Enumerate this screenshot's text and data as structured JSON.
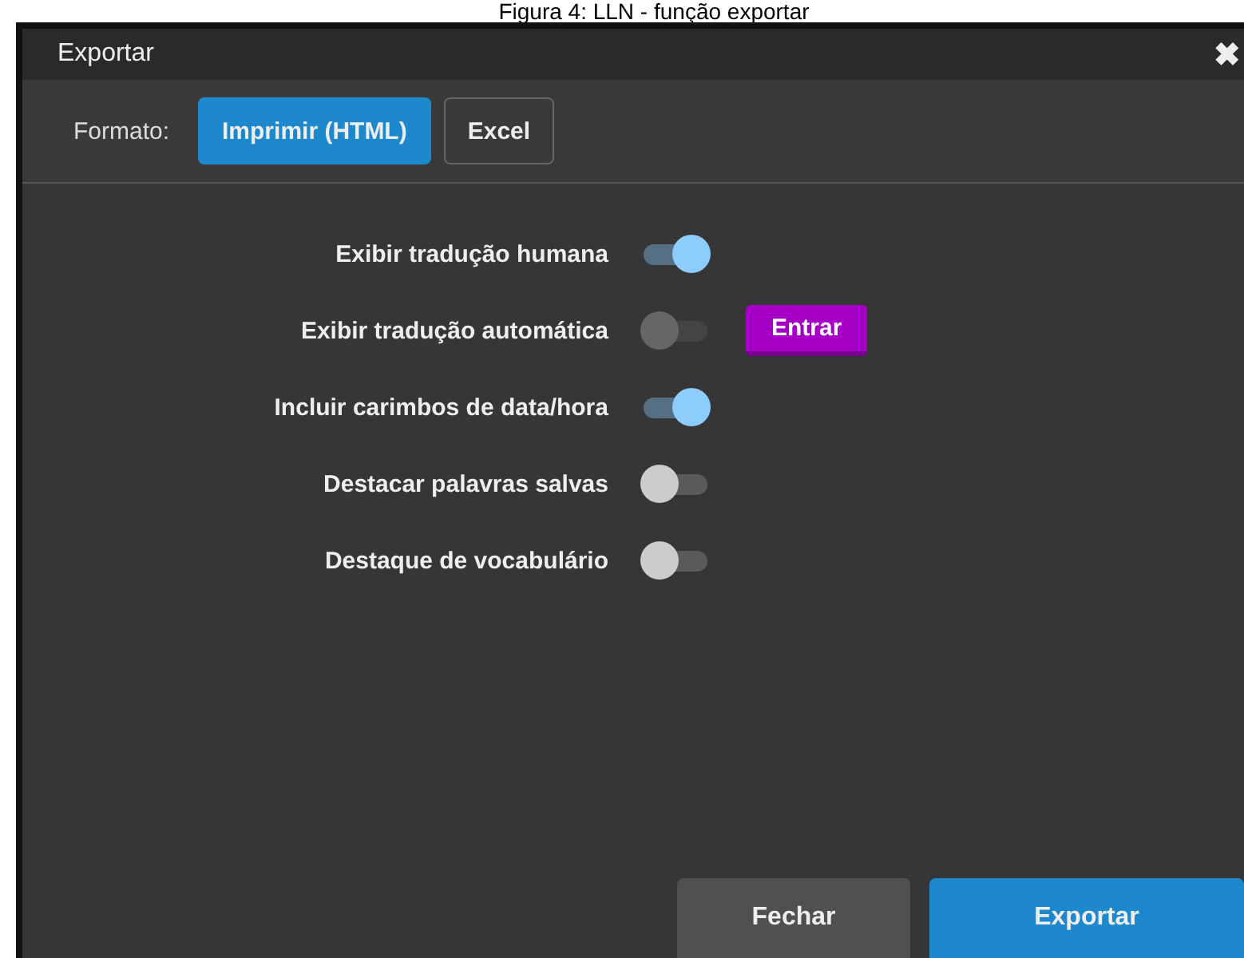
{
  "caption": "Figura 4: LLN - função exportar",
  "window": {
    "title": "Exportar",
    "close": "✖"
  },
  "format": {
    "label": "Formato:",
    "options": [
      {
        "label": "Imprimir (HTML)",
        "selected": true
      },
      {
        "label": "Excel",
        "selected": false
      }
    ]
  },
  "options": [
    {
      "label": "Exibir tradução humana",
      "on": true,
      "disabled": false
    },
    {
      "label": "Exibir tradução automática",
      "on": false,
      "disabled": true,
      "action": "Entrar"
    },
    {
      "label": "Incluir carimbos de data/hora",
      "on": true,
      "disabled": false
    },
    {
      "label": "Destacar palavras salvas",
      "on": false,
      "disabled": false
    },
    {
      "label": "Destaque de vocabulário",
      "on": false,
      "disabled": false
    }
  ],
  "buttons": [
    {
      "label": "Fechar",
      "kind": "secondary"
    },
    {
      "label": "Exportar",
      "kind": "primary"
    }
  ]
}
